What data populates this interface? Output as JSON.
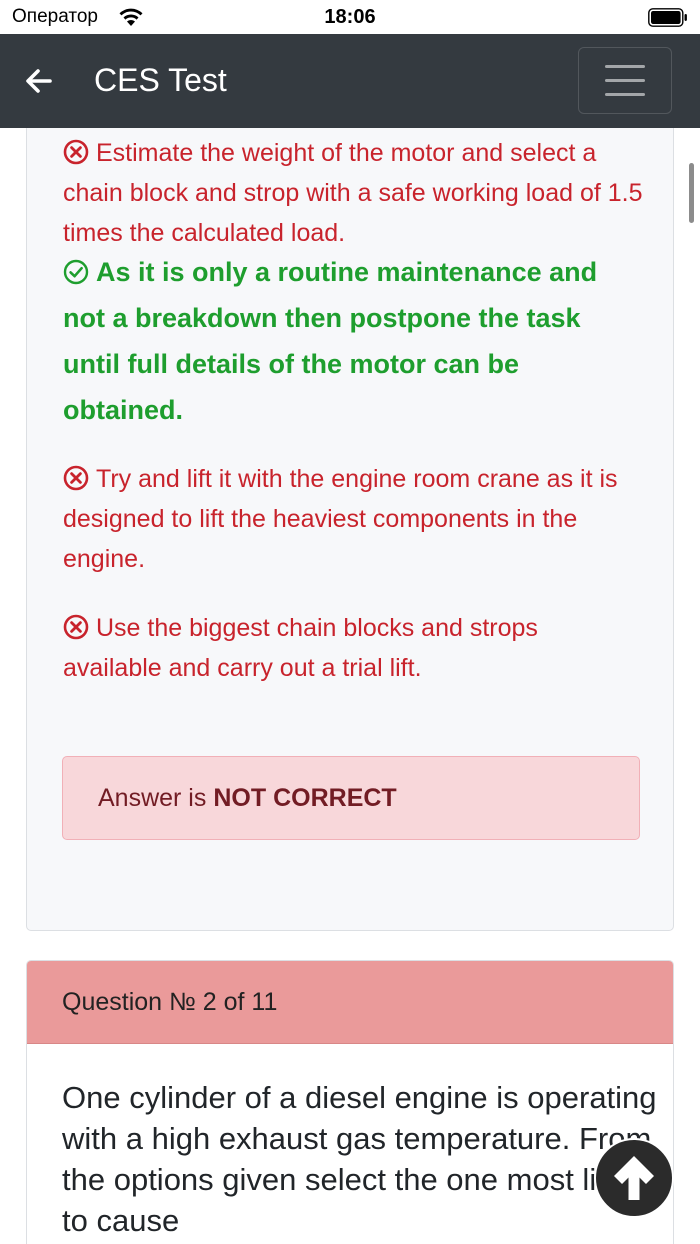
{
  "status_bar": {
    "carrier": "Оператор",
    "time": "18:06"
  },
  "navbar": {
    "title": "CES Test",
    "back_icon": "arrow-left-icon",
    "menu_icon": "hamburger-icon"
  },
  "question1": {
    "answers": [
      {
        "text": "Estimate the weight of the motor and select a chain block and strop with a safe working load of 1.5 times the calculated load.",
        "state": "wrong"
      },
      {
        "text": "As it is only a routine maintenance and not a breakdown then postpone the task until full details of the motor can be obtained.",
        "state": "correct"
      },
      {
        "text": "Try and lift it with the engine room crane as it is designed to lift the heaviest components in the engine.",
        "state": "wrong"
      },
      {
        "text": "Use the biggest chain blocks and strops available and carry out a trial lift.",
        "state": "wrong"
      }
    ],
    "result_prefix": "Answer is",
    "result_value": "NOT CORRECT"
  },
  "question2": {
    "header": "Question № 2 of 11",
    "text": "One cylinder of a diesel engine is operating with a high exhaust gas temperature. From the options given select the one most likely to cause"
  },
  "colors": {
    "wrong": "#c8232c",
    "correct": "#1e9e2e",
    "navbar": "#343a40",
    "question_header": "#ea9a9a",
    "alert_bg": "#f8d7da"
  }
}
